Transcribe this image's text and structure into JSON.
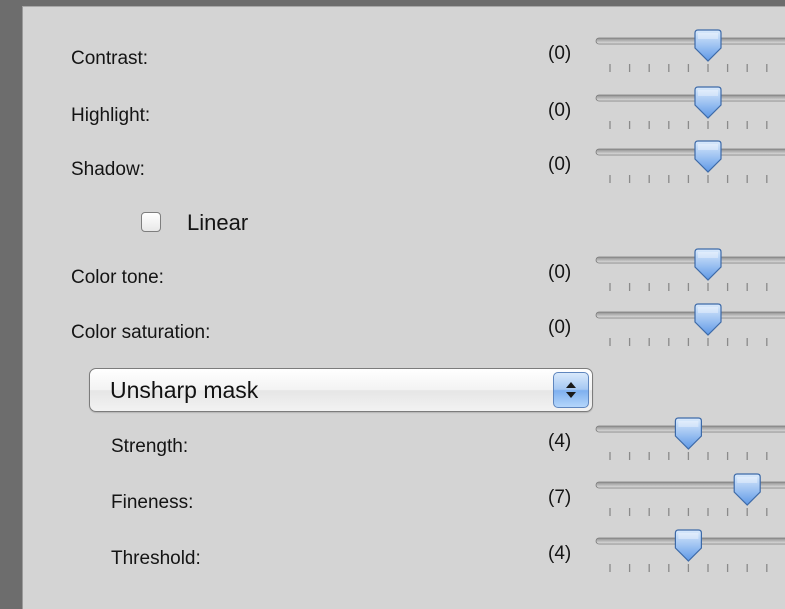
{
  "adjustments": [
    {
      "id": "contrast",
      "label": "Contrast:",
      "value_text": "(0)",
      "fraction": 0.5
    },
    {
      "id": "highlight",
      "label": "Highlight:",
      "value_text": "(0)",
      "fraction": 0.5
    },
    {
      "id": "shadow",
      "label": "Shadow:",
      "value_text": "(0)",
      "fraction": 0.5
    }
  ],
  "linear": {
    "label": "Linear",
    "checked": false
  },
  "color": [
    {
      "id": "color-tone",
      "label": "Color tone:",
      "value_text": "(0)",
      "fraction": 0.5
    },
    {
      "id": "color-saturation",
      "label": "Color saturation:",
      "value_text": "(0)",
      "fraction": 0.5
    }
  ],
  "sharpen": {
    "mode_selected": "Unsharp mask",
    "sliders": [
      {
        "id": "strength",
        "label": "Strength:",
        "value_text": "(4)",
        "fraction": 0.4
      },
      {
        "id": "fineness",
        "label": "Fineness:",
        "value_text": "(7)",
        "fraction": 0.7
      },
      {
        "id": "threshold",
        "label": "Threshold:",
        "value_text": "(4)",
        "fraction": 0.4
      }
    ]
  },
  "colors": {
    "panel": "#d4d4d4",
    "outer": "#6d6d6d",
    "thumb_top": "#dcebfc",
    "thumb_bottom": "#5e98e6",
    "thumb_border": "#3d6aa8"
  },
  "icons": {
    "slider_thumb": "slider-thumb-icon",
    "stepper": "up-down-arrows-icon"
  }
}
